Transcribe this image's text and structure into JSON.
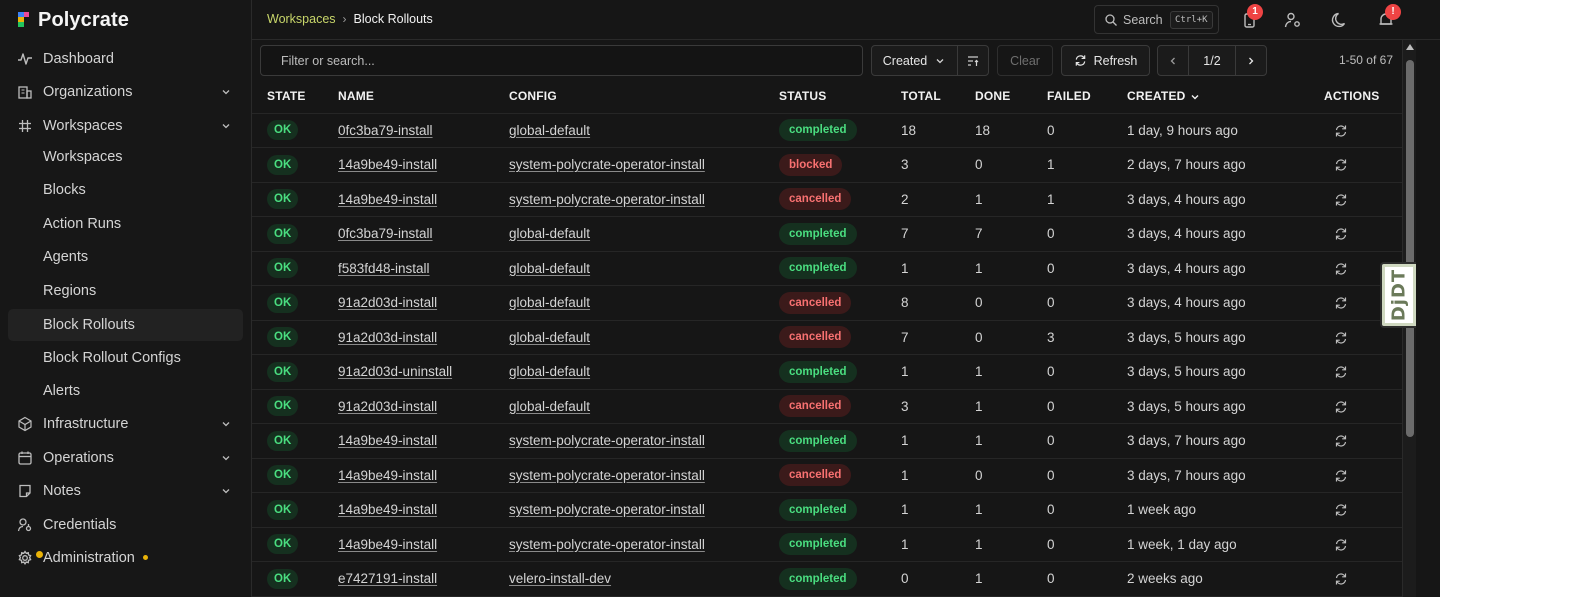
{
  "brand": {
    "name": "Polycrate"
  },
  "sidebar": {
    "items": [
      {
        "label": "Dashboard",
        "icon": "activity-icon",
        "expandable": false
      },
      {
        "label": "Organizations",
        "icon": "building-icon",
        "expandable": true
      },
      {
        "label": "Workspaces",
        "icon": "grid-icon",
        "expandable": true
      },
      {
        "label": "Infrastructure",
        "icon": "cube-icon",
        "expandable": true
      },
      {
        "label": "Operations",
        "icon": "calendar-icon",
        "expandable": true
      },
      {
        "label": "Notes",
        "icon": "note-icon",
        "expandable": true
      },
      {
        "label": "Credentials",
        "icon": "key-user-icon",
        "expandable": false
      },
      {
        "label": "Administration",
        "icon": "gear-icon",
        "expandable": false,
        "indicator": "yellow-dot"
      }
    ],
    "workspace_subitems": [
      {
        "label": "Workspaces"
      },
      {
        "label": "Blocks"
      },
      {
        "label": "Action Runs"
      },
      {
        "label": "Agents"
      },
      {
        "label": "Regions"
      },
      {
        "label": "Block Rollouts",
        "active": true
      },
      {
        "label": "Block Rollout Configs"
      },
      {
        "label": "Alerts"
      }
    ]
  },
  "header": {
    "breadcrumb": {
      "parent": "Workspaces",
      "current": "Block Rollouts"
    },
    "search": {
      "label": "Search",
      "shortcut": "Ctrl+K"
    },
    "notifications_badge": "1",
    "alerts_badge": "!"
  },
  "toolbar": {
    "filter_placeholder": "Filter or search...",
    "sort_label": "Created",
    "clear_label": "Clear",
    "refresh_label": "Refresh",
    "page_indicator": "1/2",
    "range_text": "1-50 of 67"
  },
  "table": {
    "columns": [
      "STATE",
      "NAME",
      "CONFIG",
      "STATUS",
      "TOTAL",
      "DONE",
      "FAILED",
      "CREATED",
      "ACTIONS"
    ],
    "rows": [
      {
        "state": "OK",
        "name": "0fc3ba79-install",
        "config": "global-default",
        "status": "completed",
        "total": "18",
        "done": "18",
        "failed": "0",
        "created": "1 day, 9 hours ago"
      },
      {
        "state": "OK",
        "name": "14a9be49-install",
        "config": "system-polycrate-operator-install",
        "status": "blocked",
        "total": "3",
        "done": "0",
        "failed": "1",
        "created": "2 days, 7 hours ago"
      },
      {
        "state": "OK",
        "name": "14a9be49-install",
        "config": "system-polycrate-operator-install",
        "status": "cancelled",
        "total": "2",
        "done": "1",
        "failed": "1",
        "created": "3 days, 4 hours ago"
      },
      {
        "state": "OK",
        "name": "0fc3ba79-install",
        "config": "global-default",
        "status": "completed",
        "total": "7",
        "done": "7",
        "failed": "0",
        "created": "3 days, 4 hours ago"
      },
      {
        "state": "OK",
        "name": "f583fd48-install",
        "config": "global-default",
        "status": "completed",
        "total": "1",
        "done": "1",
        "failed": "0",
        "created": "3 days, 4 hours ago"
      },
      {
        "state": "OK",
        "name": "91a2d03d-install",
        "config": "global-default",
        "status": "cancelled",
        "total": "8",
        "done": "0",
        "failed": "0",
        "created": "3 days, 4 hours ago"
      },
      {
        "state": "OK",
        "name": "91a2d03d-install",
        "config": "global-default",
        "status": "cancelled",
        "total": "7",
        "done": "0",
        "failed": "3",
        "created": "3 days, 5 hours ago"
      },
      {
        "state": "OK",
        "name": "91a2d03d-uninstall",
        "config": "global-default",
        "status": "completed",
        "total": "1",
        "done": "1",
        "failed": "0",
        "created": "3 days, 5 hours ago"
      },
      {
        "state": "OK",
        "name": "91a2d03d-install",
        "config": "global-default",
        "status": "cancelled",
        "total": "3",
        "done": "1",
        "failed": "0",
        "created": "3 days, 5 hours ago"
      },
      {
        "state": "OK",
        "name": "14a9be49-install",
        "config": "system-polycrate-operator-install",
        "status": "completed",
        "total": "1",
        "done": "1",
        "failed": "0",
        "created": "3 days, 7 hours ago"
      },
      {
        "state": "OK",
        "name": "14a9be49-install",
        "config": "system-polycrate-operator-install",
        "status": "cancelled",
        "total": "1",
        "done": "0",
        "failed": "0",
        "created": "3 days, 7 hours ago"
      },
      {
        "state": "OK",
        "name": "14a9be49-install",
        "config": "system-polycrate-operator-install",
        "status": "completed",
        "total": "1",
        "done": "1",
        "failed": "0",
        "created": "1 week ago"
      },
      {
        "state": "OK",
        "name": "14a9be49-install",
        "config": "system-polycrate-operator-install",
        "status": "completed",
        "total": "1",
        "done": "1",
        "failed": "0",
        "created": "1 week, 1 day ago"
      },
      {
        "state": "OK",
        "name": "e7427191-install",
        "config": "velero-install-dev",
        "status": "completed",
        "total": "0",
        "done": "1",
        "failed": "0",
        "created": "2 weeks ago"
      }
    ]
  },
  "debug_toolbar": {
    "label": "DjDT"
  },
  "colors": {
    "background": "#161616",
    "accent": "#c8d66a",
    "success": "#4ade80",
    "danger": "#f87171",
    "badge": "#ef4444",
    "indicator": "#eab308"
  }
}
